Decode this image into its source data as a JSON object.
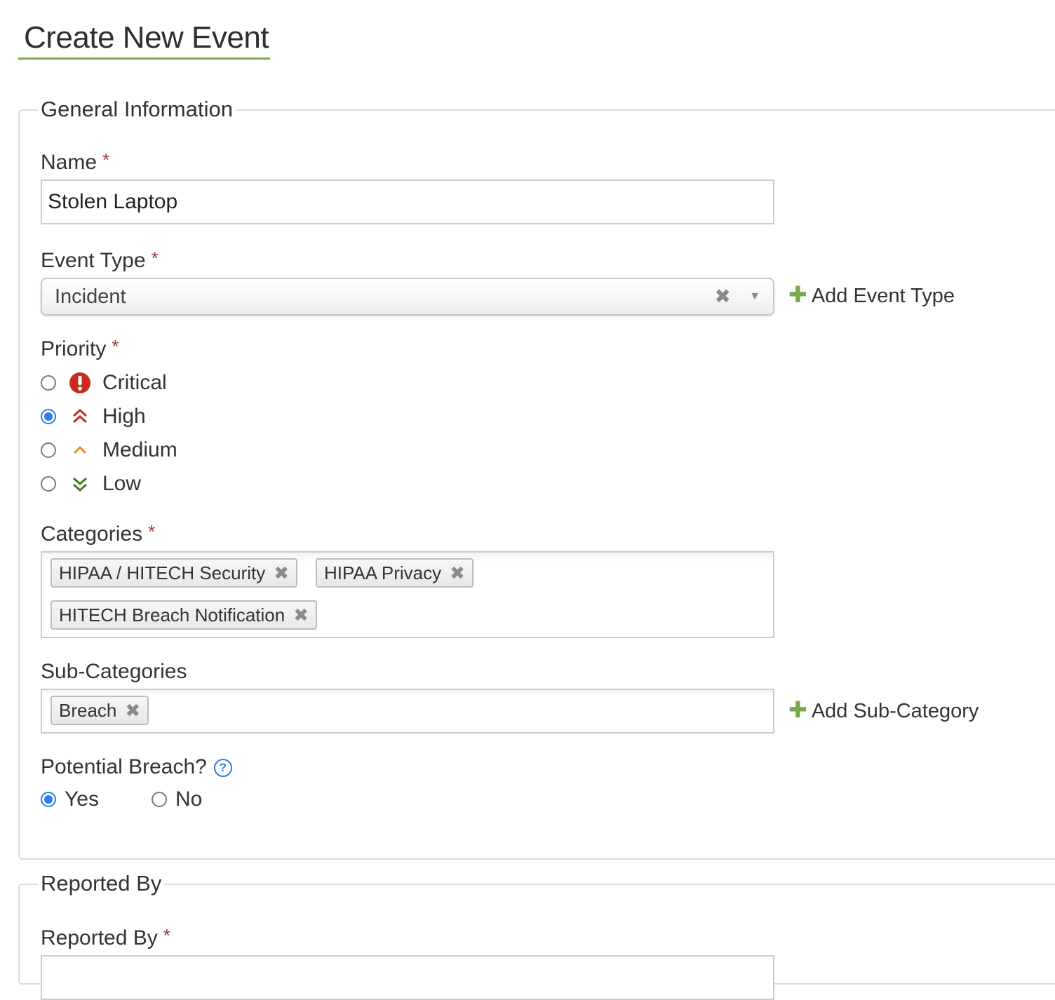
{
  "page": {
    "title": "Create New Event"
  },
  "general_info": {
    "legend": "General Information",
    "name": {
      "label": "Name",
      "required": "*",
      "value": "Stolen Laptop"
    },
    "event_type": {
      "label": "Event Type",
      "required": "*",
      "value": "Incident",
      "clear_glyph": "✖",
      "arrow_glyph": "▼",
      "add_label": "Add Event Type",
      "add_glyph": "✚"
    },
    "priority": {
      "label": "Priority",
      "required": "*",
      "options": [
        {
          "label": "Critical",
          "icon": "exclamation-circle-icon",
          "color": "#c62d1f",
          "checked": false
        },
        {
          "label": "High",
          "icon": "double-chevron-up-icon",
          "color": "#c62d1f",
          "checked": true
        },
        {
          "label": "Medium",
          "icon": "chevron-up-icon",
          "color": "#e88a2d",
          "checked": false
        },
        {
          "label": "Low",
          "icon": "double-chevron-down-icon",
          "color": "#3d7a2c",
          "checked": false
        }
      ]
    },
    "categories": {
      "label": "Categories",
      "required": "*",
      "tags": [
        "HIPAA / HITECH Security",
        "HIPAA Privacy",
        "HITECH Breach Notification"
      ],
      "remove_glyph": "✖"
    },
    "sub_categories": {
      "label": "Sub-Categories",
      "tags": [
        "Breach"
      ],
      "remove_glyph": "✖",
      "add_label": "Add Sub-Category",
      "add_glyph": "✚"
    },
    "potential_breach": {
      "label": "Potential Breach?",
      "help_glyph": "?",
      "options": [
        {
          "label": "Yes",
          "checked": true
        },
        {
          "label": "No",
          "checked": false
        }
      ]
    }
  },
  "reported_by_section": {
    "legend": "Reported By",
    "field": {
      "label": "Reported By",
      "required": "*"
    }
  },
  "colors": {
    "accent_underline": "#7fa856",
    "required": "#a23a3a",
    "radio_checked": "#2f7be8",
    "add_plus": "#77a84a"
  }
}
